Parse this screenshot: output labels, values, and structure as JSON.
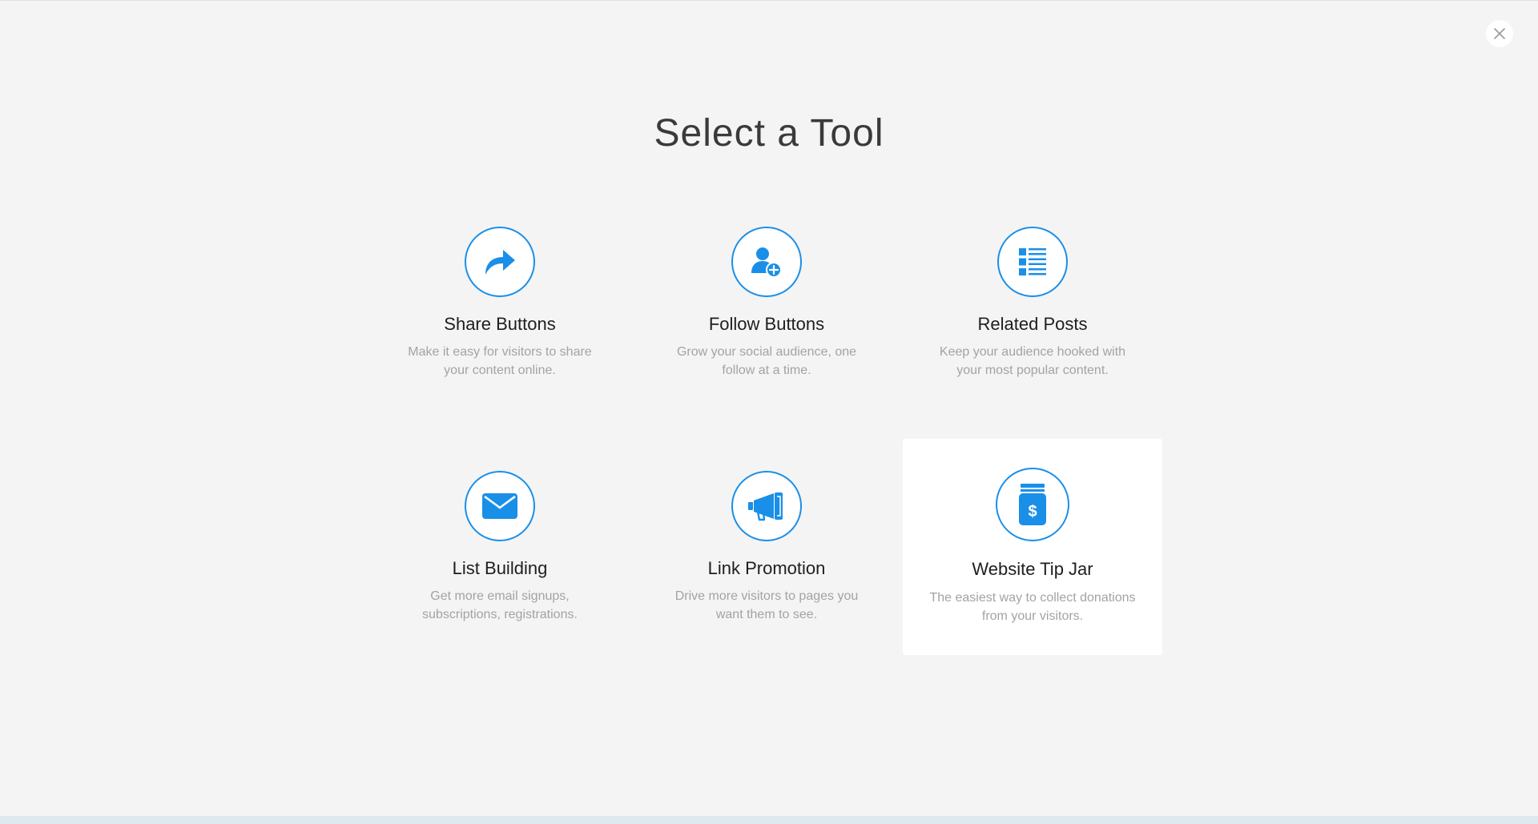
{
  "page": {
    "title": "Select a Tool",
    "accent_color": "#1a8fe8"
  },
  "close_button": {
    "icon": "close-icon"
  },
  "tools": [
    {
      "title": "Share Buttons",
      "description": "Make it easy for visitors to share your content online.",
      "icon": "share-arrow-icon",
      "selected": false
    },
    {
      "title": "Follow Buttons",
      "description": "Grow your social audience, one follow at a time.",
      "icon": "user-add-icon",
      "selected": false
    },
    {
      "title": "Related Posts",
      "description": "Keep your audience hooked with your most popular content.",
      "icon": "list-icon",
      "selected": false
    },
    {
      "title": "List Building",
      "description": "Get more email signups, subscriptions, registrations.",
      "icon": "envelope-icon",
      "selected": false
    },
    {
      "title": "Link Promotion",
      "description": "Drive more visitors to pages you want them to see.",
      "icon": "megaphone-icon",
      "selected": false
    },
    {
      "title": "Website Tip Jar",
      "description": "The easiest way to collect donations from your visitors.",
      "icon": "tip-jar-icon",
      "selected": true
    }
  ]
}
